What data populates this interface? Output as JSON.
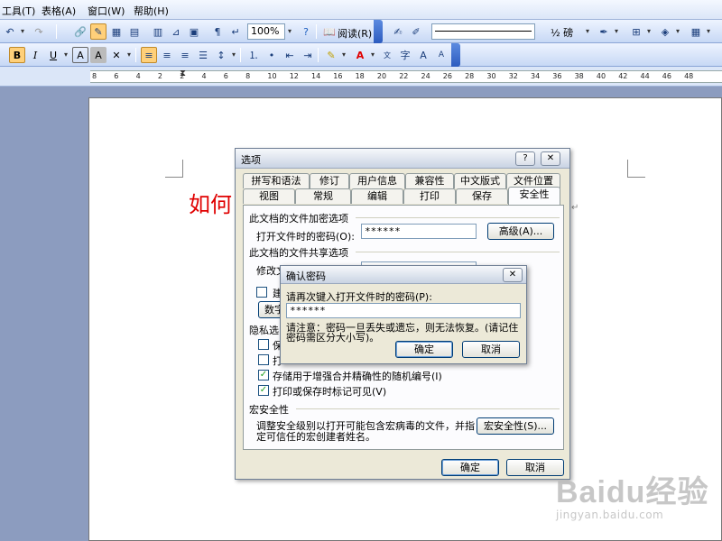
{
  "menu": [
    "工具(T)",
    "表格(A)",
    "窗口(W)",
    "帮助(H)"
  ],
  "toolbar1": {
    "zoom": "100%",
    "read_label": "阅读(R)",
    "line_weight": "½ 磅"
  },
  "ruler": {
    "ticks": [
      "8",
      "6",
      "4",
      "2",
      "2",
      "4",
      "6",
      "8",
      "10",
      "12",
      "14",
      "16",
      "18",
      "20",
      "22",
      "24",
      "26",
      "28",
      "30",
      "32",
      "34",
      "36",
      "38",
      "40",
      "42",
      "44",
      "46",
      "48"
    ]
  },
  "document": {
    "heading": "如何"
  },
  "options": {
    "title": "选项",
    "help_btn": "?",
    "close_btn": "✕",
    "tabs_row1": [
      "拼写和语法",
      "修订",
      "用户信息",
      "兼容性",
      "中文版式",
      "文件位置"
    ],
    "tabs_row2": [
      "视图",
      "常规",
      "编辑",
      "打印",
      "保存",
      "安全性"
    ],
    "encrypt_section": "此文档的文件加密选项",
    "open_password_label": "打开文件时的密码(O):",
    "open_password_value": "******",
    "advanced_btn": "高级(A)...",
    "share_section": "此文档的文件共享选项",
    "modify_password_label": "修改文",
    "readonly_label": "建",
    "digital_sig_btn": "数字",
    "privacy_section": "隐私选",
    "privacy_items": [
      {
        "label": "保",
        "checked": false
      },
      {
        "label": "打",
        "checked": false
      },
      {
        "label": "存储用于增强合并精确性的随机编号(I)",
        "checked": true
      },
      {
        "label": "打印或保存时标记可见(V)",
        "checked": true
      }
    ],
    "macro_section": "宏安全性",
    "macro_desc_line1": "调整安全级别以打开可能包含宏病毒的文件，并指",
    "macro_desc_line2": "定可信任的宏创建者姓名。",
    "macro_btn": "宏安全性(S)...",
    "ok_btn": "确定",
    "cancel_btn": "取消"
  },
  "confirm": {
    "title": "确认密码",
    "close_btn": "✕",
    "prompt": "请再次键入打开文件时的密码(P):",
    "password_value": "******",
    "note_line1": "请注意：密码一旦丢失或遗忘，则无法恢复。(请记住",
    "note_line2": "密码需区分大小写)。",
    "ok_btn": "确定",
    "cancel_btn": "取消"
  },
  "watermark": {
    "logo": "Baidu经验",
    "url": "jingyan.baidu.com"
  }
}
